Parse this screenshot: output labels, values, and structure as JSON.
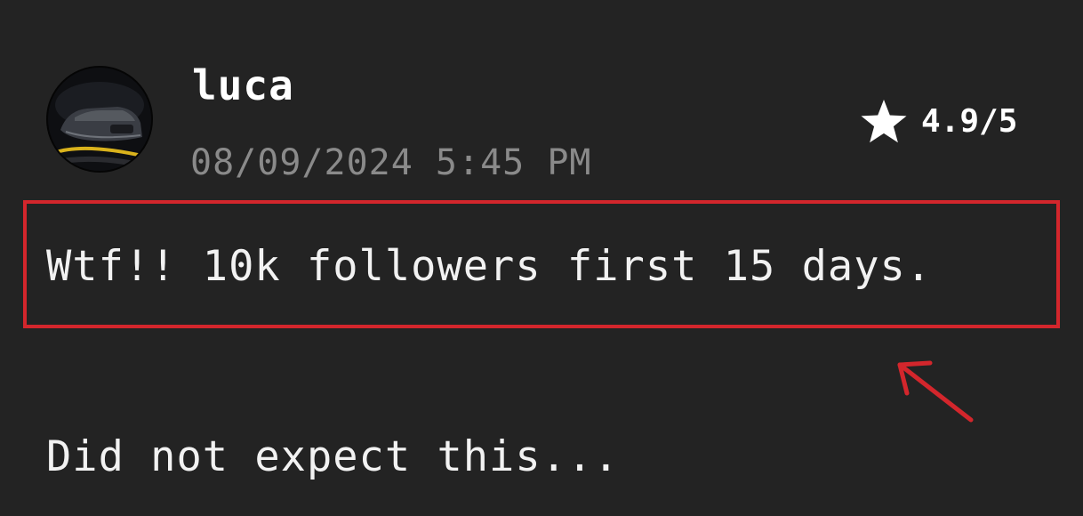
{
  "comment": {
    "author": {
      "username": "luca",
      "avatar_icon": "car-avatar-icon"
    },
    "timestamp": "08/09/2024 5:45 PM",
    "rating": {
      "icon": "star-icon",
      "value": "4.9/5",
      "level": 4.9,
      "max": 5
    },
    "text_line1": "Wtf!! 10k followers first 15 days.",
    "text_line2": "Did not expect this..."
  },
  "annotation": {
    "highlight_color": "#d3262c",
    "arrow_icon": "red-arrow-icon"
  },
  "colors": {
    "background": "#232323",
    "text": "#f2f2f2",
    "muted_text": "#8a8a8a"
  }
}
